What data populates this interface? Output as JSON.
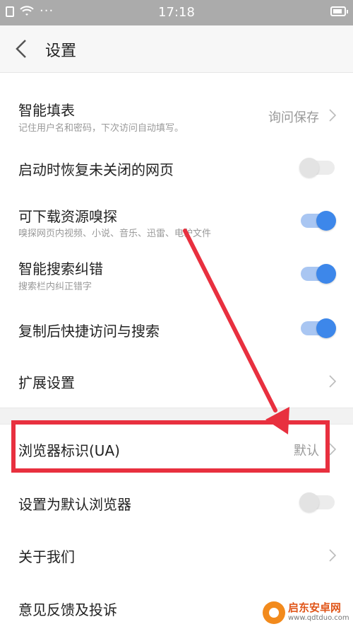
{
  "status_bar": {
    "time": "17:18",
    "dots": "···"
  },
  "header": {
    "title": "设置"
  },
  "settings": [
    {
      "title": "智能填表",
      "subtitle": "记住用户名和密码，下次访问自动填写。",
      "value": "询问保存",
      "control": "chevron"
    },
    {
      "title": "启动时恢复未关闭的网页",
      "control": "toggle",
      "enabled": false
    },
    {
      "title": "可下载资源嗅探",
      "subtitle": "嗅探网页内视频、小说、音乐、迅雷、电驴文件",
      "control": "toggle",
      "enabled": true
    },
    {
      "title": "智能搜索纠错",
      "subtitle": "搜索栏内纠正错字",
      "control": "toggle",
      "enabled": true
    },
    {
      "title": "复制后快捷访问与搜索",
      "control": "toggle",
      "enabled": true
    },
    {
      "title": "扩展设置",
      "control": "chevron"
    },
    {
      "title": "浏览器标识(UA)",
      "value": "默认",
      "control": "chevron"
    },
    {
      "title": "设置为默认浏览器",
      "control": "toggle",
      "enabled": false
    },
    {
      "title": "关于我们",
      "control": "chevron"
    },
    {
      "title": "意见反馈及投诉",
      "control": "none"
    }
  ],
  "watermark": {
    "name": "启东安卓网",
    "url": "www.qdtduo.com"
  },
  "colors": {
    "accent": "#3d87ea",
    "annotation": "#e8303f"
  }
}
